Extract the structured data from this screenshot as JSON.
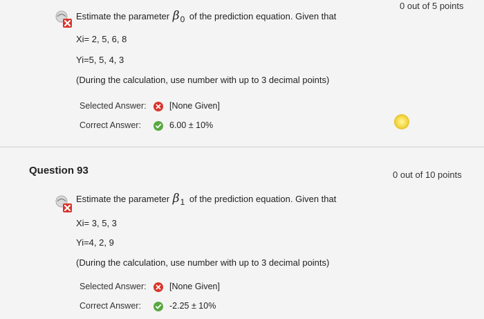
{
  "q92": {
    "points": "0 out of 5 points",
    "prompt_before": "Estimate the parameter",
    "beta": "β",
    "beta_sub": "0",
    "prompt_after": "of the prediction equation. Given that",
    "xi": "Xi= 2, 5, 6, 8",
    "yi": "Yi=5, 5, 4, 3",
    "note": "(During the calculation, use number with up to 3 decimal points)",
    "selected_label": "Selected Answer:",
    "selected_value": "[None Given]",
    "correct_label": "Correct Answer:",
    "correct_value": "6.00 ± 10%"
  },
  "q93": {
    "title": "Question 93",
    "points": "0 out of 10 points",
    "prompt_before": "Estimate the parameter",
    "beta": "β",
    "beta_sub": "1",
    "prompt_after": "of the prediction equation. Given that",
    "xi": "Xi= 3, 5, 3",
    "yi": "Yi=4, 2, 9",
    "note": "(During the calculation, use number with up to 3 decimal points)",
    "selected_label": "Selected Answer:",
    "selected_value": "[None Given]",
    "correct_label": "Correct Answer:",
    "correct_value": "-2.25 ± 10%"
  },
  "colors": {
    "incorrect": "#d9352b",
    "correct": "#5aa843",
    "highlight": "#f6dc4c"
  },
  "icons": {
    "question_status": "incorrect-x-icon",
    "selected_status": "x-circle-icon",
    "correct_status": "check-circle-icon"
  }
}
